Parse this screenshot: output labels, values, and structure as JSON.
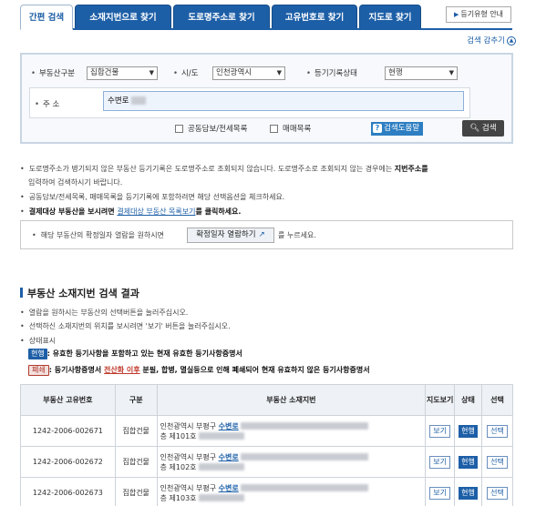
{
  "tabs": [
    {
      "label": "간편 검색",
      "active": true
    },
    {
      "label": "소재지번으로 찾기",
      "active": false
    },
    {
      "label": "도로명주소로 찾기",
      "active": false
    },
    {
      "label": "고유번호로 찾기",
      "active": false
    },
    {
      "label": "지도로 찾기",
      "active": false
    }
  ],
  "guide_button": "등기유형 안내",
  "hide_search": "검색 감추기",
  "form": {
    "type_label": "부동산구분",
    "type_value": "집합건물",
    "city_label": "시/도",
    "city_value": "인천광역시",
    "status_label": "등기기록상태",
    "status_value": "현행",
    "address_label": "주 소",
    "address_value": "수변로",
    "joint_label": "공동담보/전세목록",
    "trade_label": "매매목록",
    "help_label": "검색도움말",
    "search_label": "검색"
  },
  "notes": {
    "n1_a": "도로명주소가 병기되지 않은 부동산 등기기록은 도로명주소로 조회되지 않습니다. 도로명주소로 조회되지 않는 경우에는 ",
    "n1_b": "지번주소를",
    "n1_c": "입력하여 검색하시기 바랍니다.",
    "n2": "공동담보/전세목록, 매매목록을 등기기록에 포함하려면 해당 선택옵션을 체크하세요.",
    "n3_a": "결제대상 부동산을 보시려면 ",
    "n3_link": "결제대상 부동산 목록보기",
    "n3_b": "를 클릭하세요."
  },
  "date_box": {
    "text_before": "해당 부동산의 확정일자 열람을 원하시면",
    "button": "확정일자 열람하기",
    "text_after": "를 누르세요."
  },
  "section_title": "부동산 소재지번 검색 결과",
  "result_notes": {
    "r1": "열람을 원하시는 부동산의 선택버튼을 눌러주십시오.",
    "r2": "선택하신 소재지번의 위치를 보시려면 '보기' 버튼을 눌러주십시오.",
    "r3": "상태표시",
    "badge_current": "현행",
    "current_desc": ": 유효한 등기사항을 포함하고 있는 현재 유효한 등기사항증명서",
    "badge_closed": "폐쇄",
    "closed_a": ": 등기사항증명서 ",
    "closed_link": "전산화 이후",
    "closed_b": " 분필, 합병, 멸실등으로 인해 폐쇄되어 현재 유효하지 않은 등기사항증명서"
  },
  "table": {
    "headers": [
      "부동산 고유번호",
      "구분",
      "부동산 소재지번",
      "지도보기",
      "상태",
      "선택"
    ],
    "rows": [
      {
        "id": "1242-2006-002671",
        "type": "집합건물",
        "addr_a": "인천광역시 부평구 ",
        "addr_link": "수변로",
        "addr_line2": "층 제101호",
        "map": "보기",
        "status": "현행",
        "select": "선택"
      },
      {
        "id": "1242-2006-002672",
        "type": "집합건물",
        "addr_a": "인천광역시 부평구 ",
        "addr_link": "수변로",
        "addr_line2": "층 제102호",
        "map": "보기",
        "status": "현행",
        "select": "선택"
      },
      {
        "id": "1242-2006-002673",
        "type": "집합건물",
        "addr_a": "인천광역시 부평구 ",
        "addr_link": "수변로",
        "addr_line2": "층 제103호",
        "map": "보기",
        "status": "현행",
        "select": "선택"
      }
    ]
  }
}
